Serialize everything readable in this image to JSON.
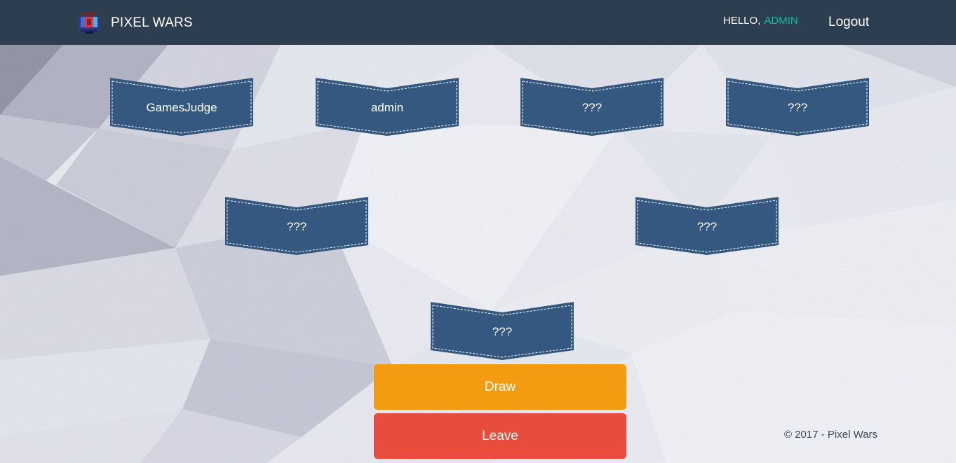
{
  "navbar": {
    "brand": "PIXEL WARS",
    "greeting": "HELLO,",
    "username": "ADMIN",
    "logout_label": "Logout"
  },
  "slots": [
    {
      "label": "GamesJudge"
    },
    {
      "label": "admin"
    },
    {
      "label": "???"
    },
    {
      "label": "???"
    },
    {
      "label": "???"
    },
    {
      "label": "???"
    },
    {
      "label": "???"
    }
  ],
  "actions": {
    "draw_label": "Draw",
    "leave_label": "Leave"
  },
  "footer": {
    "copyright": "© 2017 - Pixel Wars"
  },
  "colors": {
    "navbar": "#2c3e50",
    "accent": "#18bc9c",
    "slot": "#34587f",
    "draw": "#f39c12",
    "leave": "#e74c3c"
  },
  "icons": {
    "brand": "pixel-shield-icon"
  }
}
